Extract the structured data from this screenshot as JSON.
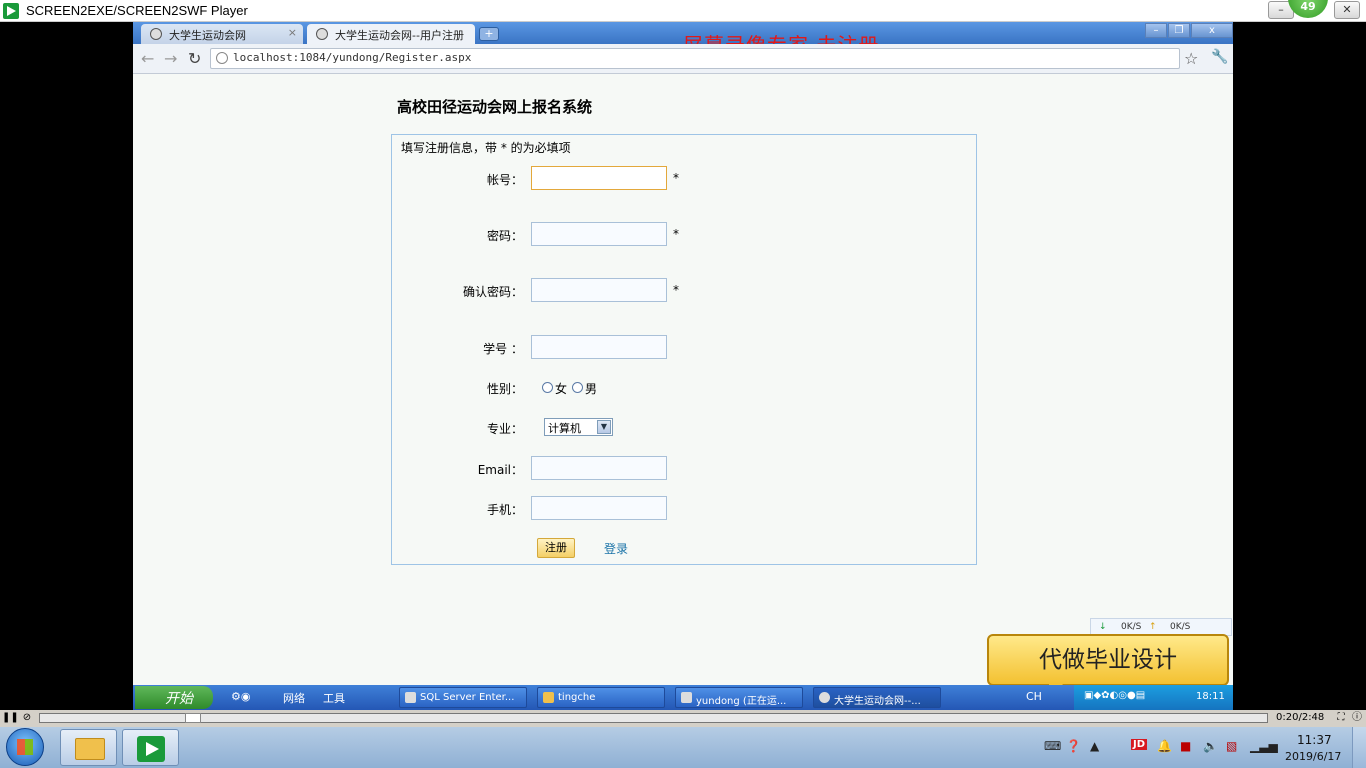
{
  "player": {
    "title": "SCREEN2EXE/SCREEN2SWF Player",
    "badge": "49",
    "time": "0:20/2:48"
  },
  "browser": {
    "tabs": [
      {
        "label": "大学生运动会网"
      },
      {
        "label": "大学生运动会网--用户注册"
      }
    ],
    "new_tab": "+",
    "url": "localhost:1084/yundong/Register.aspx",
    "watermark": "屏幕录像专家  未注册"
  },
  "page": {
    "title": "高校田径运动会网上报名系统",
    "hint": "填写注册信息，带 * 的为必填项",
    "required_mark": "*",
    "fields": {
      "account": {
        "label": "帐号：",
        "value": ""
      },
      "password": {
        "label": "密码：",
        "value": ""
      },
      "confirm": {
        "label": "确认密码：",
        "value": ""
      },
      "student_no": {
        "label": "学号 ：",
        "value": ""
      },
      "gender": {
        "label": "性别：",
        "options": [
          "女",
          "男"
        ]
      },
      "major": {
        "label": "专业：",
        "selected": "计算机"
      },
      "email": {
        "label": "Email：",
        "value": ""
      },
      "phone": {
        "label": "手机：",
        "value": ""
      }
    },
    "register_label": "注册",
    "login_label": "登录"
  },
  "net_widget": {
    "down": "0K/S",
    "up": "0K/S"
  },
  "ad": "代做毕业设计",
  "inner_taskbar": {
    "start": "开始",
    "tools": [
      "网络",
      "工具"
    ],
    "tasks": [
      "SQL Server Enter...",
      "tingche",
      "yundong (正在运...",
      "大学生运动会网--..."
    ],
    "lang": "CH",
    "clock": "18:11"
  },
  "taskbar": {
    "jd": "JD",
    "time": "11:37",
    "date": "2019/6/17"
  },
  "colors": {
    "watermark": "#e21818",
    "link": "#1a73a8",
    "form_border": "#9ec4e6"
  }
}
